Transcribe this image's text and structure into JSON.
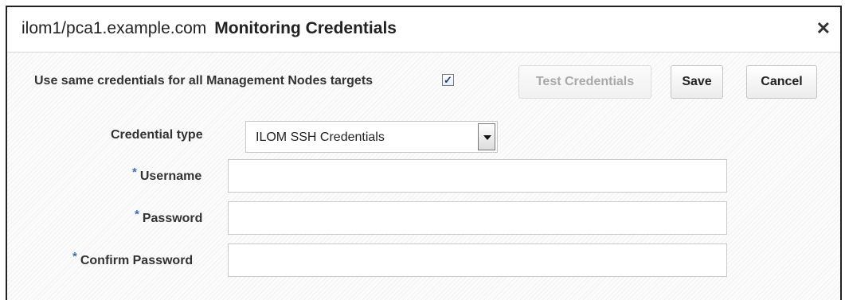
{
  "dialog": {
    "host": "ilom1/pca1.example.com",
    "title": "Monitoring Credentials",
    "close_glyph": "✕"
  },
  "options": {
    "same_credentials_label": "Use same credentials for all Management Nodes targets",
    "same_credentials_checked": true,
    "check_glyph": "✓"
  },
  "buttons": {
    "test": "Test Credentials",
    "save": "Save",
    "cancel": "Cancel"
  },
  "form": {
    "required_marker": "*",
    "credential_type_label": "Credential type",
    "credential_type_value": "ILOM SSH Credentials",
    "username_label": "Username",
    "username_value": "",
    "password_label": "Password",
    "password_value": "",
    "confirm_password_label": "Confirm Password",
    "confirm_password_value": ""
  }
}
